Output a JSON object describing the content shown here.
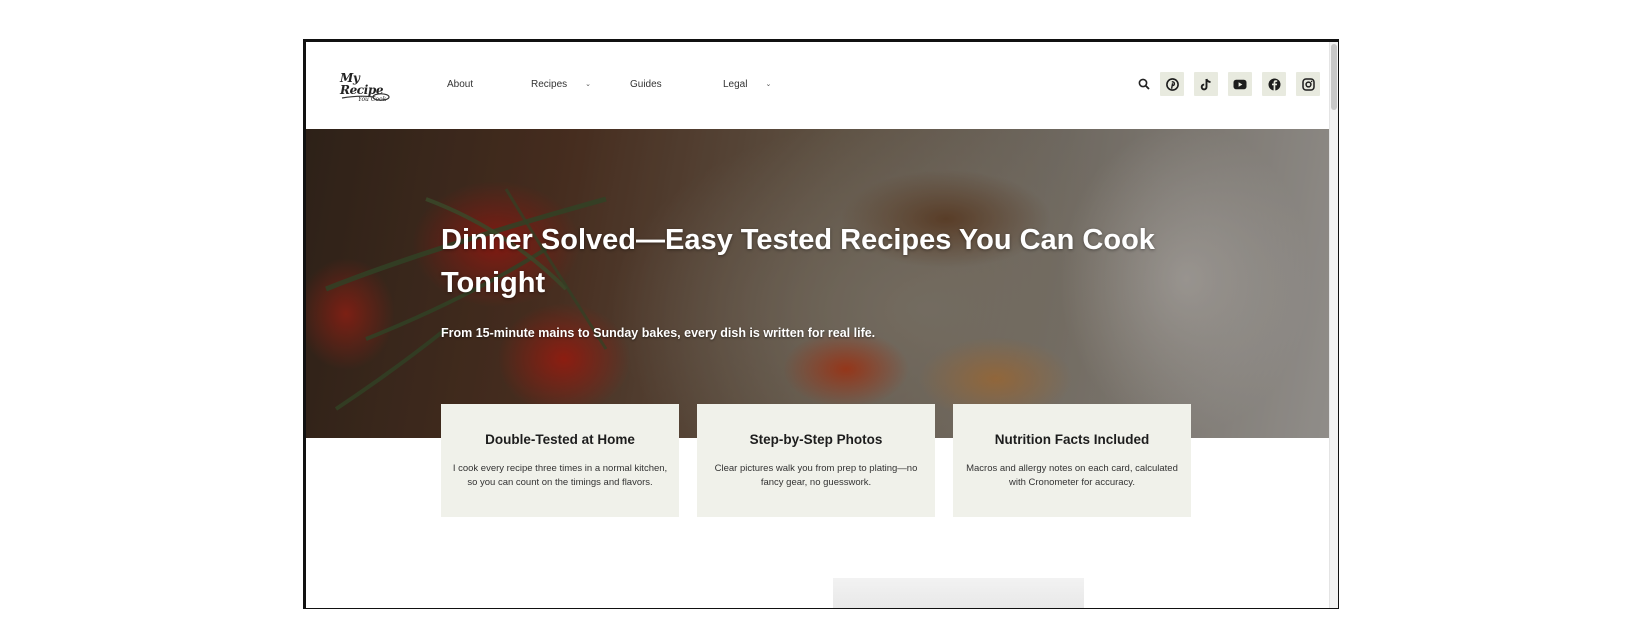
{
  "site": {
    "logo_text": "My Recipe",
    "logo_sub": "You Cook"
  },
  "nav": {
    "items": [
      {
        "label": "About",
        "has_dropdown": false
      },
      {
        "label": "Recipes",
        "has_dropdown": true
      },
      {
        "label": "Guides",
        "has_dropdown": false
      },
      {
        "label": "Legal",
        "has_dropdown": true
      }
    ],
    "dropdown_glyph": "⌄"
  },
  "header_icons": {
    "search": "search-icon",
    "social": [
      "pinterest-icon",
      "tiktok-icon",
      "youtube-icon",
      "facebook-icon",
      "instagram-icon"
    ]
  },
  "hero": {
    "title": "Dinner Solved—Easy Tested Recipes You Can Cook Tonight",
    "subtitle": "From 15-minute mains to Sunday bakes, every dish is written for real life."
  },
  "features": [
    {
      "title": "Double-Tested at Home",
      "text": "I cook every recipe three times in a normal kitchen, so you can count on the timings and flavors."
    },
    {
      "title": "Step-by-Step Photos",
      "text": "Clear pictures walk you from prep to plating—no fancy gear, no guesswork."
    },
    {
      "title": "Nutrition Facts Included",
      "text": "Macros and allergy notes on each card, calculated with Cronometer for accuracy."
    }
  ],
  "colors": {
    "card_bg": "#f0f1ea",
    "social_bg": "#e8eadf",
    "text_dark": "#1d1d1d"
  }
}
